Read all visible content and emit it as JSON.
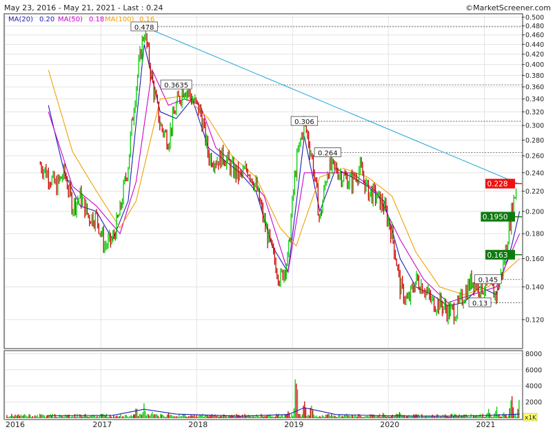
{
  "header": {
    "range": "May 23, 2016 - May 21, 2021 - Last : 0.24",
    "copyright": "©MarketScreener.com",
    "ma20_label": "MA(20)",
    "ma20_value": "0.20",
    "ma50_label": "MA(50)",
    "ma50_value": "0.18",
    "ma100_label": "MA(100)",
    "ma100_value": "0.16"
  },
  "colors": {
    "up": "#00cc00",
    "down": "#cc0000",
    "ma20": "#1c1cb4",
    "ma50": "#cc00cc",
    "ma100": "#f0a000",
    "trendline": "#19a3d9",
    "volume_ma": "#1c1cb4",
    "last_price_flag": "#ee1111",
    "level_flag": "#0e7a0e"
  },
  "chart_data": [
    {
      "type": "line",
      "subtype": "candlestick-like price series with moving averages",
      "x_ticks": [
        "2016",
        "2017",
        "2018",
        "2019",
        "2020",
        "2021"
      ],
      "y_ticks": [
        "0.120",
        "0.140",
        "0.160",
        "0.180",
        "0.200",
        "0.220",
        "0.240",
        "0.260",
        "0.280",
        "0.300",
        "0.320",
        "0.340",
        "0.360",
        "0.380",
        "0.400",
        "0.420",
        "0.440",
        "0.460",
        "0.480",
        "0.500"
      ],
      "ylim": [
        0.105,
        0.505
      ],
      "grid": true,
      "series": [
        {
          "name": "Price",
          "points": [
            [
              "2016-05",
              0.25
            ],
            [
              "2016-07",
              0.225
            ],
            [
              "2016-08",
              0.24
            ],
            [
              "2016-09",
              0.205
            ],
            [
              "2016-10",
              0.215
            ],
            [
              "2016-11",
              0.195
            ],
            [
              "2016-12",
              0.195
            ],
            [
              "2017-01",
              0.17
            ],
            [
              "2017-02",
              0.175
            ],
            [
              "2017-03",
              0.2
            ],
            [
              "2017-04",
              0.25
            ],
            [
              "2017-05",
              0.36
            ],
            [
              "2017-06",
              0.47
            ],
            [
              "2017-07",
              0.37
            ],
            [
              "2017-08",
              0.3
            ],
            [
              "2017-09",
              0.28
            ],
            [
              "2017-10",
              0.33
            ],
            [
              "2017-11",
              0.36
            ],
            [
              "2017-12",
              0.34
            ],
            [
              "2018-01",
              0.32
            ],
            [
              "2018-02",
              0.26
            ],
            [
              "2018-03",
              0.255
            ],
            [
              "2018-04",
              0.26
            ],
            [
              "2018-05",
              0.245
            ],
            [
              "2018-06",
              0.235
            ],
            [
              "2018-07",
              0.245
            ],
            [
              "2018-08",
              0.225
            ],
            [
              "2018-09",
              0.19
            ],
            [
              "2018-10",
              0.165
            ],
            [
              "2018-11",
              0.145
            ],
            [
              "2018-12",
              0.16
            ],
            [
              "2019-01",
              0.25
            ],
            [
              "2019-02",
              0.305
            ],
            [
              "2019-03",
              0.26
            ],
            [
              "2019-04",
              0.19
            ],
            [
              "2019-05",
              0.245
            ],
            [
              "2019-06",
              0.245
            ],
            [
              "2019-07",
              0.235
            ],
            [
              "2019-08",
              0.23
            ],
            [
              "2019-09",
              0.245
            ],
            [
              "2019-10",
              0.22
            ],
            [
              "2019-11",
              0.215
            ],
            [
              "2019-12",
              0.205
            ],
            [
              "2020-01",
              0.18
            ],
            [
              "2020-02",
              0.14
            ],
            [
              "2020-03",
              0.13
            ],
            [
              "2020-04",
              0.145
            ],
            [
              "2020-05",
              0.14
            ],
            [
              "2020-06",
              0.13
            ],
            [
              "2020-07",
              0.13
            ],
            [
              "2020-08",
              0.125
            ],
            [
              "2020-09",
              0.125
            ],
            [
              "2020-10",
              0.135
            ],
            [
              "2020-11",
              0.145
            ],
            [
              "2020-12",
              0.14
            ],
            [
              "2021-01",
              0.14
            ],
            [
              "2021-02",
              0.135
            ],
            [
              "2021-03",
              0.155
            ],
            [
              "2021-04",
              0.2
            ],
            [
              "2021-05",
              0.24
            ]
          ]
        },
        {
          "name": "MA(20)",
          "points": [
            [
              "2016-06",
              0.33
            ],
            [
              "2016-08",
              0.24
            ],
            [
              "2016-10",
              0.205
            ],
            [
              "2016-12",
              0.2
            ],
            [
              "2017-02",
              0.175
            ],
            [
              "2017-04",
              0.21
            ],
            [
              "2017-06",
              0.44
            ],
            [
              "2017-08",
              0.32
            ],
            [
              "2017-10",
              0.31
            ],
            [
              "2017-12",
              0.34
            ],
            [
              "2018-02",
              0.27
            ],
            [
              "2018-04",
              0.255
            ],
            [
              "2018-06",
              0.24
            ],
            [
              "2018-08",
              0.22
            ],
            [
              "2018-10",
              0.17
            ],
            [
              "2018-12",
              0.15
            ],
            [
              "2019-02",
              0.285
            ],
            [
              "2019-04",
              0.2
            ],
            [
              "2019-06",
              0.245
            ],
            [
              "2019-08",
              0.235
            ],
            [
              "2019-10",
              0.225
            ],
            [
              "2019-12",
              0.21
            ],
            [
              "2020-02",
              0.16
            ],
            [
              "2020-04",
              0.14
            ],
            [
              "2020-06",
              0.135
            ],
            [
              "2020-08",
              0.128
            ],
            [
              "2020-10",
              0.13
            ],
            [
              "2020-12",
              0.14
            ],
            [
              "2021-02",
              0.135
            ],
            [
              "2021-04",
              0.17
            ],
            [
              "2021-05",
              0.2
            ]
          ]
        },
        {
          "name": "MA(50)",
          "points": [
            [
              "2016-06",
              0.32
            ],
            [
              "2016-09",
              0.225
            ],
            [
              "2016-12",
              0.205
            ],
            [
              "2017-03",
              0.18
            ],
            [
              "2017-05",
              0.23
            ],
            [
              "2017-07",
              0.39
            ],
            [
              "2017-09",
              0.33
            ],
            [
              "2017-11",
              0.34
            ],
            [
              "2018-01",
              0.33
            ],
            [
              "2018-03",
              0.27
            ],
            [
              "2018-06",
              0.245
            ],
            [
              "2018-09",
              0.215
            ],
            [
              "2018-12",
              0.15
            ],
            [
              "2019-02",
              0.24
            ],
            [
              "2019-05",
              0.24
            ],
            [
              "2019-08",
              0.24
            ],
            [
              "2019-11",
              0.22
            ],
            [
              "2020-02",
              0.175
            ],
            [
              "2020-05",
              0.145
            ],
            [
              "2020-08",
              0.13
            ],
            [
              "2020-11",
              0.135
            ],
            [
              "2021-02",
              0.14
            ],
            [
              "2021-05",
              0.18
            ]
          ]
        },
        {
          "name": "MA(100)",
          "points": [
            [
              "2016-06",
              0.39
            ],
            [
              "2016-09",
              0.265
            ],
            [
              "2016-12",
              0.22
            ],
            [
              "2017-03",
              0.185
            ],
            [
              "2017-05",
              0.21
            ],
            [
              "2017-08",
              0.34
            ],
            [
              "2017-11",
              0.345
            ],
            [
              "2018-02",
              0.31
            ],
            [
              "2018-05",
              0.26
            ],
            [
              "2018-08",
              0.235
            ],
            [
              "2018-11",
              0.185
            ],
            [
              "2019-01",
              0.17
            ],
            [
              "2019-04",
              0.235
            ],
            [
              "2019-07",
              0.245
            ],
            [
              "2019-10",
              0.235
            ],
            [
              "2020-01",
              0.215
            ],
            [
              "2020-04",
              0.165
            ],
            [
              "2020-07",
              0.14
            ],
            [
              "2020-10",
              0.135
            ],
            [
              "2021-01",
              0.14
            ],
            [
              "2021-05",
              0.16
            ]
          ]
        }
      ],
      "trendline": [
        [
          "2017-06",
          0.478
        ],
        [
          "2021-05",
          0.228
        ]
      ],
      "annotations": [
        {
          "label": "0.478",
          "y": 0.478,
          "x": "2017-06"
        },
        {
          "label": "0.3635",
          "y": 0.3635,
          "x": "2017-10"
        },
        {
          "label": "0.306",
          "y": 0.306,
          "x": "2019-02"
        },
        {
          "label": "0.264",
          "y": 0.264,
          "x": "2019-05"
        },
        {
          "label": "0.145",
          "y": 0.145,
          "x": "2021-01"
        },
        {
          "label": "0.13",
          "y": 0.13,
          "x": "2020-12"
        }
      ],
      "flags": [
        {
          "label": "0.228",
          "y": 0.228,
          "kind": "last"
        },
        {
          "label": "0.1950",
          "y": 0.195,
          "kind": "level"
        },
        {
          "label": "0.163",
          "y": 0.163,
          "kind": "level"
        }
      ]
    },
    {
      "type": "bar",
      "subtype": "volume",
      "y_ticks": [
        "2000",
        "4000",
        "6000",
        "8000"
      ],
      "ylim": [
        0,
        8200
      ],
      "unit_label": "x1K",
      "peaks": [
        [
          "2016-06",
          600
        ],
        [
          "2016-10",
          450
        ],
        [
          "2017-01",
          700
        ],
        [
          "2017-05",
          1800
        ],
        [
          "2017-06",
          2500
        ],
        [
          "2017-07",
          1500
        ],
        [
          "2017-09",
          900
        ],
        [
          "2017-11",
          700
        ],
        [
          "2018-03",
          400
        ],
        [
          "2018-08",
          300
        ],
        [
          "2018-12",
          1500
        ],
        [
          "2019-01",
          8200
        ],
        [
          "2019-02",
          3000
        ],
        [
          "2019-03",
          2500
        ],
        [
          "2019-05",
          900
        ],
        [
          "2019-08",
          600
        ],
        [
          "2019-12",
          900
        ],
        [
          "2020-02",
          1000
        ],
        [
          "2020-04",
          700
        ],
        [
          "2020-08",
          500
        ],
        [
          "2020-12",
          900
        ],
        [
          "2021-01",
          1700
        ],
        [
          "2021-02",
          2000
        ],
        [
          "2021-03",
          1000
        ],
        [
          "2021-04",
          4800
        ],
        [
          "2021-05",
          3000
        ]
      ],
      "moving_average": [
        [
          "2016-06",
          300
        ],
        [
          "2017-02",
          350
        ],
        [
          "2017-06",
          1100
        ],
        [
          "2017-10",
          500
        ],
        [
          "2018-06",
          250
        ],
        [
          "2018-12",
          450
        ],
        [
          "2019-02",
          1300
        ],
        [
          "2019-06",
          450
        ],
        [
          "2019-12",
          300
        ],
        [
          "2020-06",
          250
        ],
        [
          "2020-12",
          300
        ],
        [
          "2021-05",
          500
        ]
      ]
    }
  ]
}
